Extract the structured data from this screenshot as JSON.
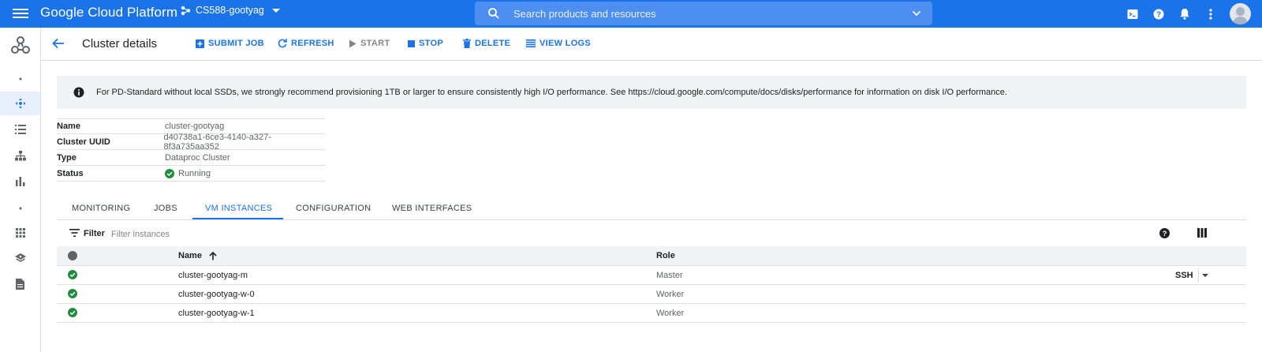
{
  "topbar": {
    "brand": "Google Cloud Platform",
    "project": "CS588-gootyag",
    "search_placeholder": "Search products and resources",
    "icons": [
      "menu-icon",
      "cloud-shell-icon",
      "help-icon",
      "notifications-icon",
      "more-vert-icon",
      "account-avatar"
    ]
  },
  "leftnav": {
    "items": [
      "dataproc-logo",
      "dot",
      "clusters",
      "jobs",
      "workflows",
      "autoscaling",
      "dot",
      "metastore",
      "components",
      "notebooks"
    ]
  },
  "header": {
    "title": "Cluster details",
    "actions": {
      "submit_job": "SUBMIT JOB",
      "refresh": "REFRESH",
      "start": "START",
      "stop": "STOP",
      "delete": "DELETE",
      "view_logs": "VIEW LOGS"
    }
  },
  "banner": {
    "text": "For PD-Standard without local SSDs, we strongly recommend provisioning 1TB or larger to ensure consistently high I/O performance. See https://cloud.google.com/compute/docs/disks/performance for information on disk I/O performance."
  },
  "details": {
    "name_label": "Name",
    "name_value": "cluster-gootyag",
    "uuid_label": "Cluster UUID",
    "uuid_value": "d40738a1-6ce3-4140-a327-8f3a735aa352",
    "type_label": "Type",
    "type_value": "Dataproc Cluster",
    "status_label": "Status",
    "status_value": "Running"
  },
  "tabs": [
    "MONITORING",
    "JOBS",
    "VM INSTANCES",
    "CONFIGURATION",
    "WEB INTERFACES"
  ],
  "active_tab": "VM INSTANCES",
  "filter": {
    "label": "Filter",
    "placeholder": "Filter instances"
  },
  "table": {
    "headers": {
      "name": "Name",
      "role": "Role"
    },
    "rows": [
      {
        "name": "cluster-gootyag-m",
        "role": "Master",
        "ssh": "SSH"
      },
      {
        "name": "cluster-gootyag-w-0",
        "role": "Worker"
      },
      {
        "name": "cluster-gootyag-w-1",
        "role": "Worker"
      }
    ]
  },
  "colors": {
    "primary": "#1a73e8",
    "success": "#1e8e3e",
    "banner_bg": "#f1f3f4"
  }
}
